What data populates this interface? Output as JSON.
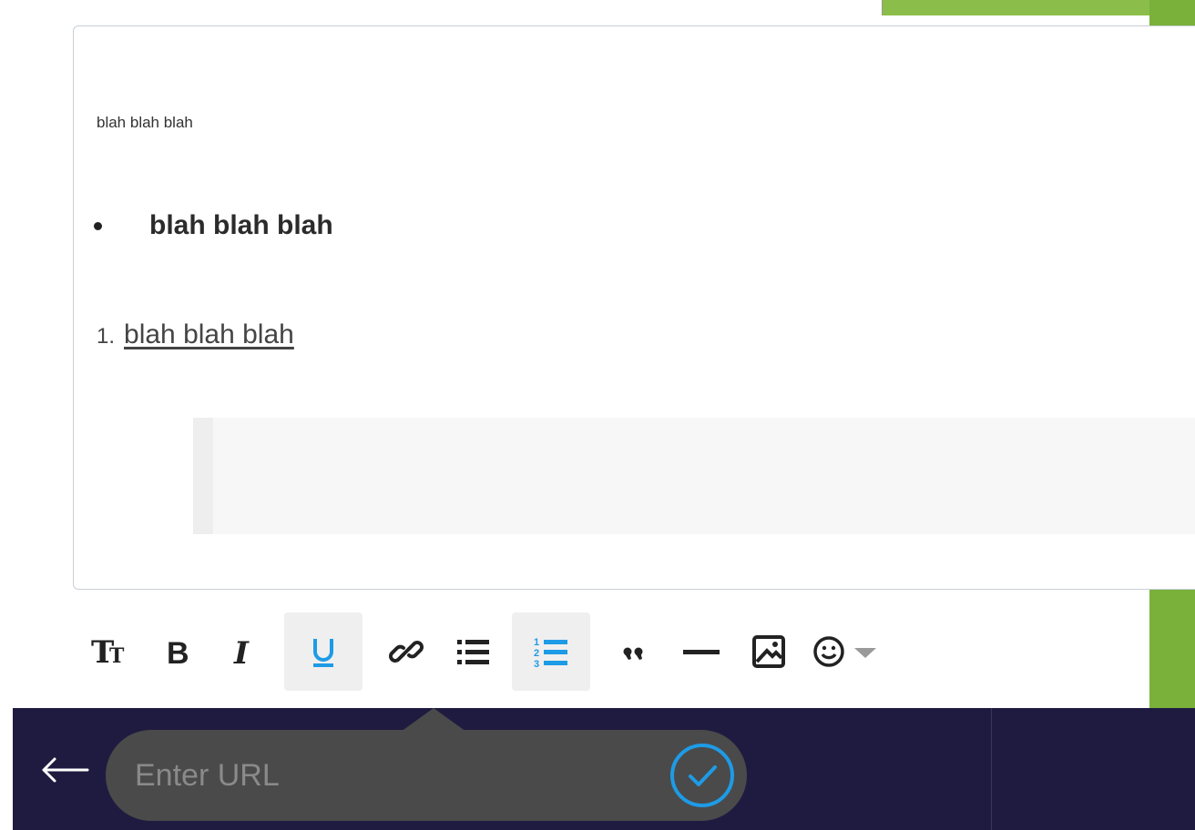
{
  "colors": {
    "accent": "#1e9be6",
    "bottom_bar": "#1f1b40",
    "right_strip": "#79b13a",
    "popup": "#4a4a4a"
  },
  "editor": {
    "paragraph": "blah blah blah",
    "bullet_item": "blah blah blah",
    "ordered_number": "1.",
    "ordered_item": "blah blah blah"
  },
  "toolbar": {
    "items": [
      {
        "name": "text-size-icon",
        "label": "Tт",
        "active": false
      },
      {
        "name": "bold-icon",
        "active": false
      },
      {
        "name": "italic-icon",
        "active": false
      },
      {
        "name": "underline-icon",
        "active": true
      },
      {
        "name": "link-icon",
        "active": false
      },
      {
        "name": "bullet-list-icon",
        "active": false
      },
      {
        "name": "numbered-list-icon",
        "active": true
      },
      {
        "name": "blockquote-icon",
        "active": false
      },
      {
        "name": "horizontal-rule-icon",
        "active": false
      },
      {
        "name": "image-icon",
        "active": false
      },
      {
        "name": "emoji-icon",
        "active": false
      }
    ]
  },
  "link_popup": {
    "placeholder": "Enter URL",
    "value": ""
  }
}
